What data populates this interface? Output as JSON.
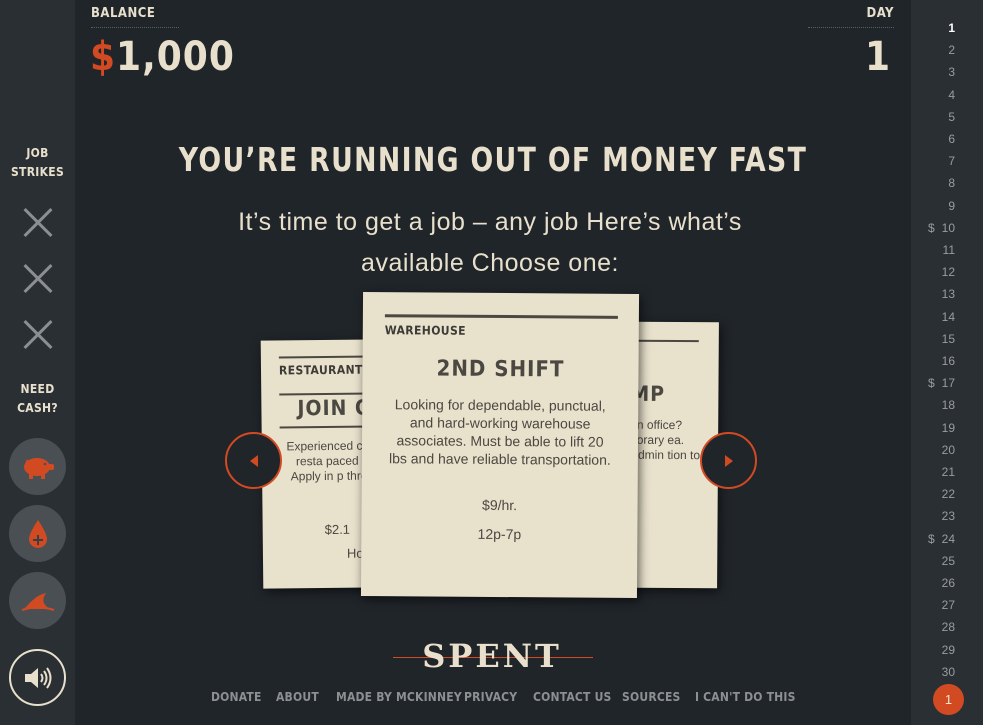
{
  "header": {
    "balance_label": "BALANCE",
    "currency": "$",
    "balance": "1,000",
    "day_label": "DAY",
    "day": "1"
  },
  "sidebar": {
    "job_strikes_label_1": "JOB",
    "job_strikes_label_2": "STRIKES",
    "need_cash_label_1": "NEED",
    "need_cash_label_2": "CASH?",
    "buttons": [
      "piggy-bank-icon",
      "blood-drop-plus-icon",
      "shark-fin-icon"
    ],
    "sound_icon": "speaker-icon"
  },
  "main": {
    "headline": "YOU’RE RUNNING OUT OF MONEY FAST",
    "subtitle": "It’s time to get a job – any job Here’s what’s available Choose one:"
  },
  "cards": {
    "left": {
      "category": "RESTAURANT",
      "title": "JOIN O",
      "desc": "Experienced casual resta paced and Apply in p through",
      "pay": "$2.1",
      "hours": "Ho"
    },
    "center": {
      "category": "WAREHOUSE",
      "title": "2ND SHIFT",
      "desc": "Looking for dependable, punctual, and hard-working warehouse associates. Must be able to lift 20 lbs and have reliable transportation.",
      "pay": "$9/hr.",
      "hours": "12p-7p"
    },
    "right": {
      "title": "MP",
      "desc": "an office? porary ea. Admin tion to"
    }
  },
  "days": [
    "1",
    "2",
    "3",
    "4",
    "5",
    "6",
    "7",
    "8",
    "9",
    "10",
    "11",
    "12",
    "13",
    "14",
    "15",
    "16",
    "17",
    "18",
    "19",
    "20",
    "21",
    "22",
    "23",
    "24",
    "25",
    "26",
    "27",
    "28",
    "29",
    "30"
  ],
  "payday_marker": "$",
  "current_day": "1",
  "logo": "SPENT",
  "footer": {
    "donate": "DONATE",
    "about": "ABOUT",
    "made_by": "MADE BY MCKINNEY",
    "privacy": "PRIVACY",
    "contact": "CONTACT US",
    "sources": "SOURCES",
    "cant": "I CAN'T DO THIS"
  },
  "colors": {
    "background": "#20252a",
    "accent": "#d24a22",
    "card": "#e8e1cc",
    "text": "#e8e0cc"
  }
}
